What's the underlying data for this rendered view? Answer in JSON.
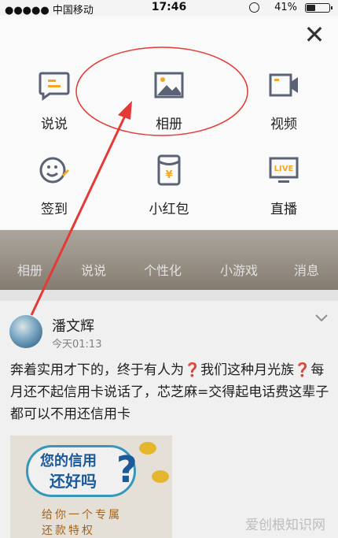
{
  "status": {
    "carrier": "●●●●● 中国移动",
    "time": "17:46",
    "battery": "41%",
    "battery_level": 0.41
  },
  "menu": {
    "items": [
      {
        "label": "说说",
        "icon": "message-icon"
      },
      {
        "label": "相册",
        "icon": "photo-album-icon"
      },
      {
        "label": "视频",
        "icon": "video-camera-icon"
      },
      {
        "label": "签到",
        "icon": "check-in-icon"
      },
      {
        "label": "小红包",
        "icon": "red-packet-icon"
      },
      {
        "label": "直播",
        "icon": "live-tv-icon"
      }
    ],
    "close": "✕"
  },
  "feed_nav": [
    "相册",
    "说说",
    "个性化",
    "小游戏",
    "消息"
  ],
  "post": {
    "author": "潘文辉",
    "time": "今天01:13",
    "text": "奔着实用才下的，终于有人为❓我们这种月光族❓每月还不起信用卡说话了，芯芝麻=交得起电话费这辈子都可以不用还信用卡",
    "image_text_1": "您的信用",
    "image_text_2": "还好吗",
    "image_text_3": "给你一个专属",
    "image_text_4": "还款特权"
  },
  "watermark": "爱创根知识网",
  "colors": {
    "accent_orange": "#f5a623",
    "icon_gray": "#5b6275",
    "annotation_red": "#e53935"
  }
}
